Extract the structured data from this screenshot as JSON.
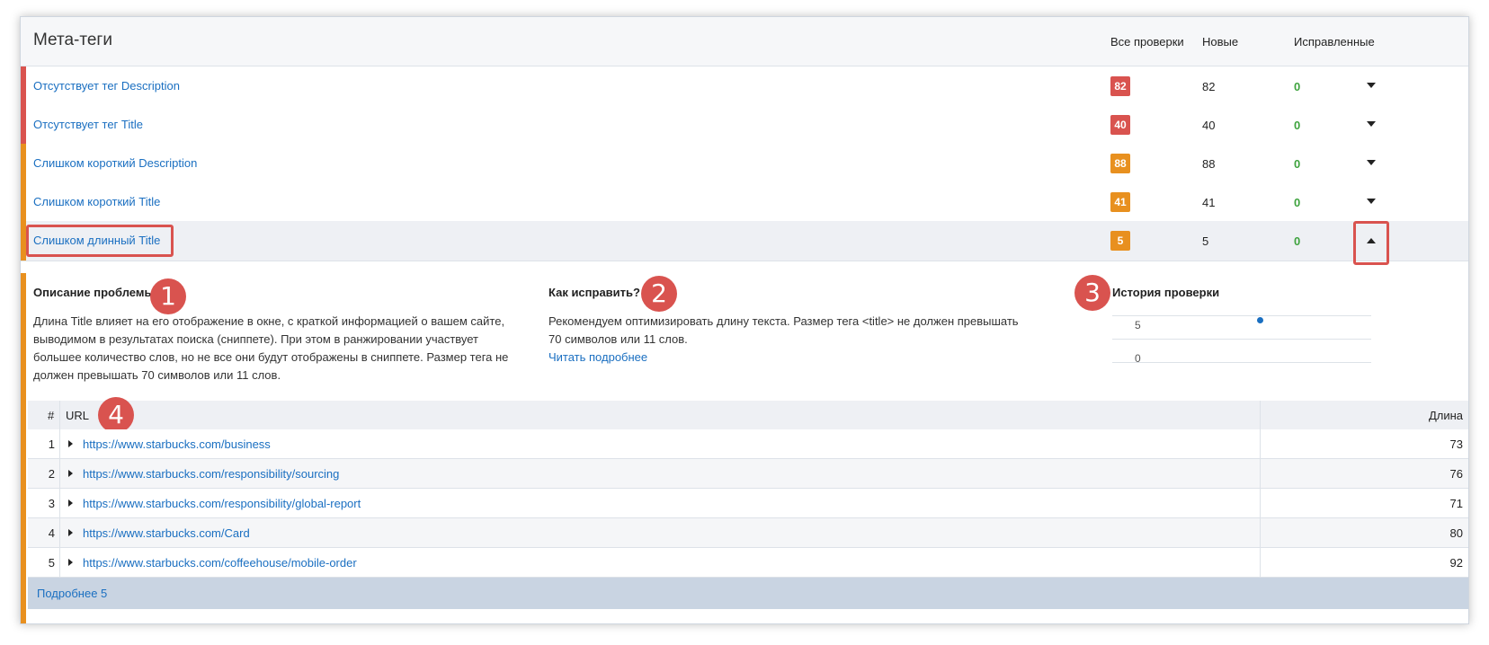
{
  "header": {
    "title": "Мета-теги",
    "col_all": "Все проверки",
    "col_new": "Новые",
    "col_fixed": "Исправленные"
  },
  "rows": [
    {
      "name": "Отсутствует тег Description",
      "all": "82",
      "new": "82",
      "fixed": "0",
      "color": "#d9534f"
    },
    {
      "name": "Отсутствует тег Title",
      "all": "40",
      "new": "40",
      "fixed": "0",
      "color": "#d9534f"
    },
    {
      "name": "Слишком короткий Description",
      "all": "88",
      "new": "88",
      "fixed": "0",
      "color": "#e8901f"
    },
    {
      "name": "Слишком короткий Title",
      "all": "41",
      "new": "41",
      "fixed": "0",
      "color": "#e8901f"
    },
    {
      "name": "Слишком длинный Title",
      "all": "5",
      "new": "5",
      "fixed": "0",
      "color": "#e8901f"
    }
  ],
  "detail": {
    "problem_title": "Описание проблемы",
    "problem_text_1": "Длина Title влияет на его отображение в окне, с краткой информацией о вашем сайте,",
    "problem_text_2": "выводимом в результатах поиска (сниппете). При этом в ранжировании участвует",
    "problem_text_3": "большее количество слов, но не все они будут отображены в сниппете. Размер тега не",
    "problem_text_4": "должен превышать 70 символов или 11 слов.",
    "fix_title": "Как исправить?",
    "fix_text_1": "Рекомендуем оптимизировать длину текста. Размер тега <title> не должен превышать",
    "fix_text_2": "70 символов или 11 слов.",
    "fix_link": "Читать подробнее",
    "history_title": "История проверки",
    "history_ticks": [
      "5",
      "0"
    ],
    "history_value": 5,
    "markers": [
      "1",
      "2",
      "3",
      "4"
    ]
  },
  "table": {
    "col_num": "#",
    "col_url": "URL",
    "col_len": "Длина",
    "rows": [
      {
        "n": "1",
        "url": "https://www.starbucks.com/business",
        "len": "73"
      },
      {
        "n": "2",
        "url": "https://www.starbucks.com/responsibility/sourcing",
        "len": "76"
      },
      {
        "n": "3",
        "url": "https://www.starbucks.com/responsibility/global-report",
        "len": "71"
      },
      {
        "n": "4",
        "url": "https://www.starbucks.com/Card",
        "len": "80"
      },
      {
        "n": "5",
        "url": "https://www.starbucks.com/coffeehouse/mobile-order",
        "len": "92"
      }
    ],
    "more_label": "Подробнее 5"
  },
  "colors": {
    "error": "#d9534f",
    "warning": "#e8901f",
    "link": "#1a6fc1",
    "fixed": "#3fa33f"
  }
}
